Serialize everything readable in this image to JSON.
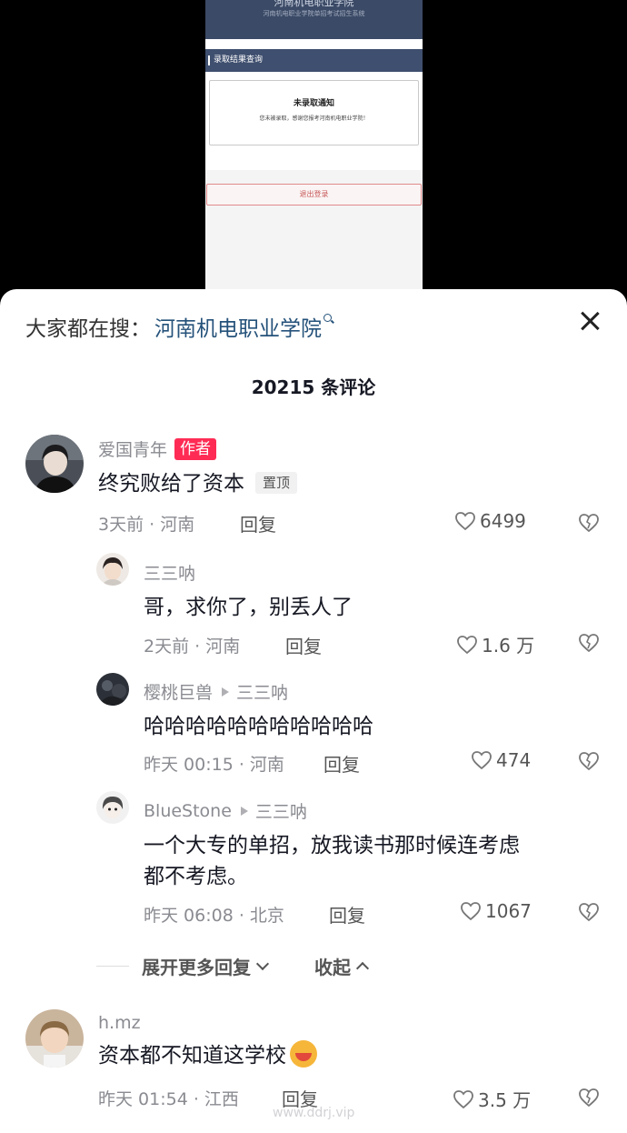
{
  "phone": {
    "header_title": "河南机电职业学院",
    "header_subtitle": "河南机电职业学院单招考试招生系统",
    "section_title": "录取结果查询",
    "notice_title": "未录取通知",
    "notice_body": "您未被录取，感谢您报考河南机电职业学院！",
    "logout_label": "退出登录"
  },
  "search": {
    "prefix": "大家都在搜：",
    "keyword": "河南机电职业学院"
  },
  "comment_count": "20215 条评论",
  "comments": [
    {
      "user": "爱国青年",
      "badge": "作者",
      "text": "终究败给了资本",
      "pin": "置顶",
      "meta": "3天前 · 河南",
      "reply": "回复",
      "likes": "6499"
    },
    {
      "user": "三三呐",
      "text": "哥，求你了，别丢人了",
      "meta": "2天前 · 河南",
      "reply": "回复",
      "likes": "1.6 万"
    },
    {
      "user": "樱桃巨兽",
      "reply_to": "三三呐",
      "text": "哈哈哈哈哈哈哈哈哈哈哈",
      "meta": "昨天 00:15 · 河南",
      "reply": "回复",
      "likes": "474"
    },
    {
      "user": "BlueStone",
      "reply_to": "三三呐",
      "text_line1": "一个大专的单招，放我读书那时候连考虑",
      "text_line2": "都不考虑。",
      "meta": "昨天 06:08 · 北京",
      "reply": "回复",
      "likes": "1067"
    },
    {
      "user": "h.mz",
      "text": "资本都不知道这学校",
      "meta": "昨天 01:54 · 江西",
      "reply": "回复",
      "likes": "3.5 万"
    }
  ],
  "expand": {
    "more_label": "展开更多回复",
    "collapse_label": "收起"
  },
  "watermark": "www.ddrj.vip"
}
